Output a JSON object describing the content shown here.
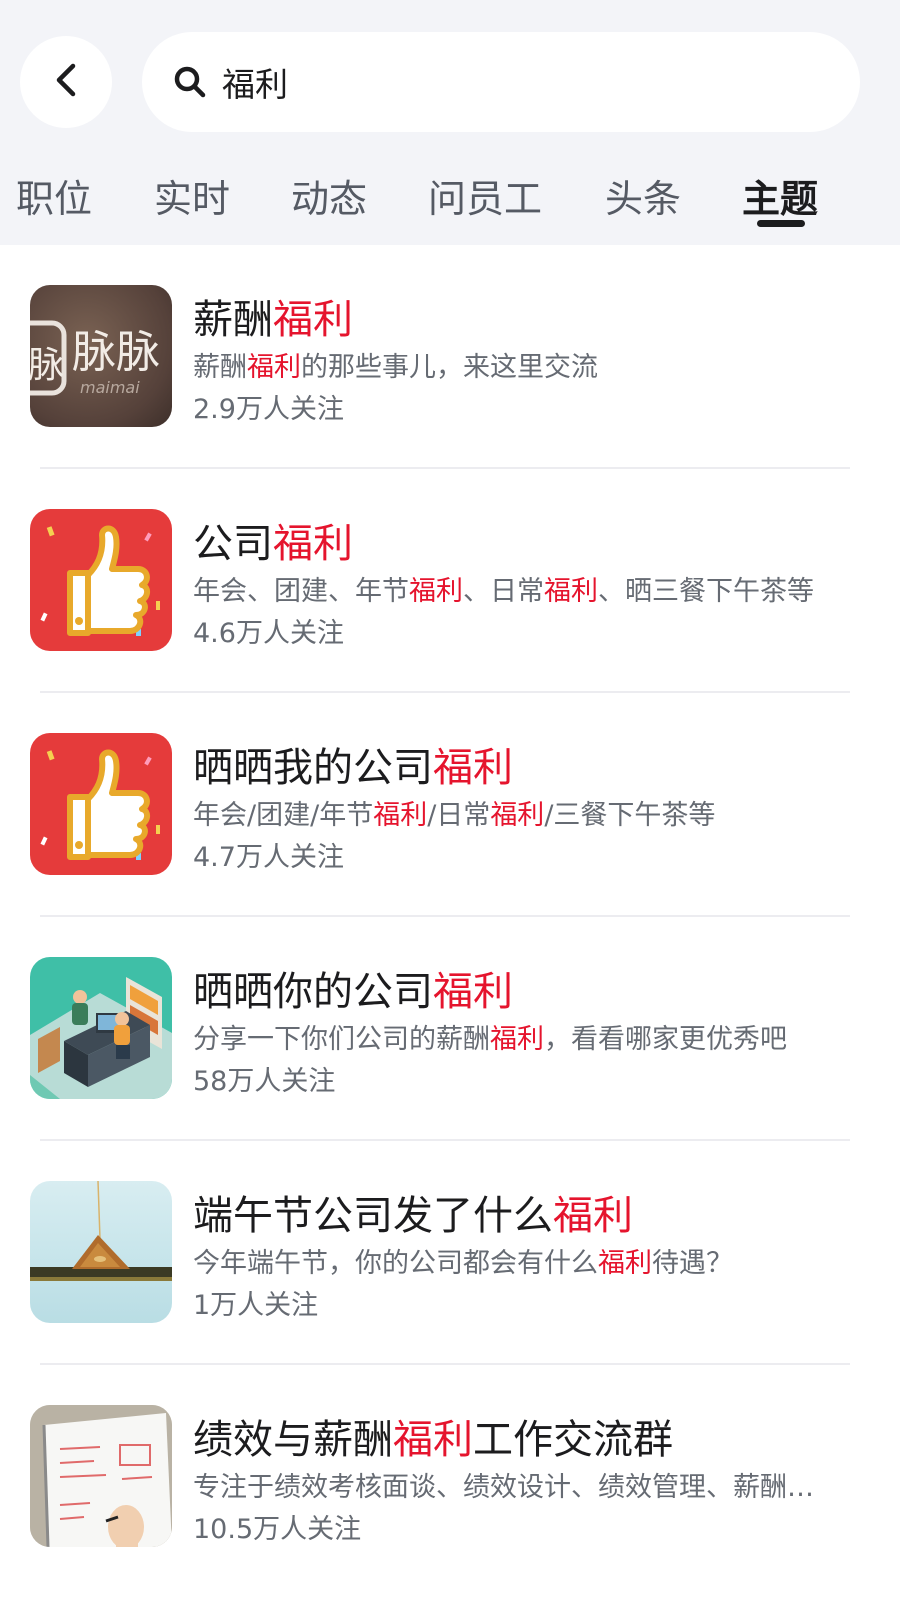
{
  "search": {
    "query": "福利"
  },
  "tabs": [
    {
      "label": "职位"
    },
    {
      "label": "实时"
    },
    {
      "label": "动态"
    },
    {
      "label": "问员工"
    },
    {
      "label": "头条"
    },
    {
      "label": "主题"
    }
  ],
  "active_tab": "主题",
  "topics": [
    {
      "title_a": "薪酬",
      "title_hl": "福利",
      "title_b": "",
      "desc_a": "薪酬",
      "desc_hl1": "福利",
      "desc_b": "的那些事儿，来这里交流",
      "desc_hl2": "",
      "desc_c": "",
      "followers": "2.9万人关注",
      "thumb": "maimai-logo-thumbnail",
      "thumb_text": "脉脉",
      "thumb_subtext": "maimai"
    },
    {
      "title_a": "公司",
      "title_hl": "福利",
      "title_b": "",
      "desc_a": "年会、团建、年节",
      "desc_hl1": "福利",
      "desc_b": "、日常",
      "desc_hl2": "福利",
      "desc_c": "、晒三餐下午茶等",
      "followers": "4.6万人关注",
      "thumb": "thumbs-up-thumbnail"
    },
    {
      "title_a": "晒晒我的公司",
      "title_hl": "福利",
      "title_b": "",
      "desc_a": "年会/团建/年节",
      "desc_hl1": "福利",
      "desc_b": "/日常",
      "desc_hl2": "福利",
      "desc_c": "/三餐下午茶等",
      "followers": "4.7万人关注",
      "thumb": "thumbs-up-thumbnail"
    },
    {
      "title_a": "晒晒你的公司",
      "title_hl": "福利",
      "title_b": "",
      "desc_a": "分享一下你们公司的薪酬",
      "desc_hl1": "福利",
      "desc_b": "，看看哪家更优秀吧",
      "desc_hl2": "",
      "desc_c": "",
      "followers": "58万人关注",
      "thumb": "office-illustration-thumbnail"
    },
    {
      "title_a": "端午节公司发了什么",
      "title_hl": "福利",
      "title_b": "",
      "desc_a": "今年端午节，你的公司都会有什么",
      "desc_hl1": "福利",
      "desc_b": "待遇？",
      "desc_hl2": "",
      "desc_c": "",
      "followers": "1万人关注",
      "thumb": "zongzi-photo-thumbnail"
    },
    {
      "title_a": "绩效与薪酬",
      "title_hl": "福利",
      "title_b": "工作交流群",
      "desc_a": "专注于绩效考核面谈、绩效设计、绩效管理、薪酬设计",
      "desc_hl1": "",
      "desc_b": "",
      "desc_hl2": "",
      "desc_c": "",
      "followers": "10.5万人关注",
      "thumb": "whiteboard-photo-thumbnail"
    }
  ],
  "colors": {
    "highlight": "#e5142d",
    "header_bg": "#f3f4f8",
    "thumbs_red": "#e53b3b",
    "thumbs_gold": "#e8a92b"
  }
}
